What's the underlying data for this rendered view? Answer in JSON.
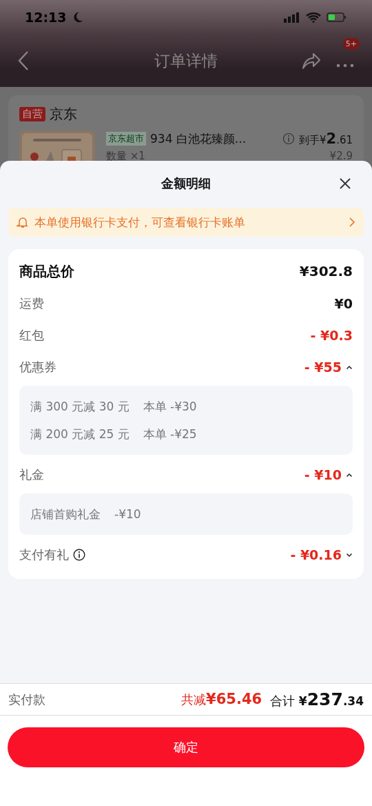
{
  "status_bar": {
    "time": "12:13"
  },
  "nav": {
    "title": "订单详情",
    "badge": "5+"
  },
  "order_card": {
    "store_badge": "自营",
    "store_name": "京东",
    "product": {
      "tag": "京东超市",
      "name": "934 白池花臻颜...",
      "price_label": "到手",
      "price_currency": "¥",
      "price_integer": "2",
      "price_decimal": ".61",
      "quantity": "数量 ×1",
      "original_price": "¥2.9"
    }
  },
  "sheet": {
    "title": "金额明细",
    "notice": {
      "text": "本单使用银行卡支付，可查看银行卡账单"
    },
    "rows": [
      {
        "kind": "total",
        "label": "商品总价",
        "amount": "¥302.8",
        "discount": false
      },
      {
        "kind": "plain",
        "label": "运费",
        "amount": "¥0",
        "discount": false
      },
      {
        "kind": "plain",
        "label": "红包",
        "amount": "- ¥0.3",
        "discount": true
      },
      {
        "kind": "expandable",
        "label": "优惠券",
        "amount": "- ¥55",
        "discount": true,
        "expanded": true,
        "details": [
          {
            "name": "满 300 元减 30 元",
            "value": "本单 -¥30"
          },
          {
            "name": "满 200 元减 25 元",
            "value": "本单 -¥25"
          }
        ]
      },
      {
        "kind": "expandable",
        "label": "礼金",
        "amount": "- ¥10",
        "discount": true,
        "expanded": true,
        "details": [
          {
            "name": "店铺首购礼金",
            "value": "-¥10"
          }
        ]
      },
      {
        "kind": "info",
        "label": "支付有礼",
        "amount": "- ¥0.16",
        "discount": true,
        "expanded": false
      }
    ]
  },
  "footer": {
    "label": "实付款",
    "saved_label": "共减",
    "saved_amount": "¥65.46",
    "total_label": "合计",
    "total_currency": "¥",
    "total_integer": "237",
    "total_decimal": ".34",
    "confirm": "确定"
  }
}
